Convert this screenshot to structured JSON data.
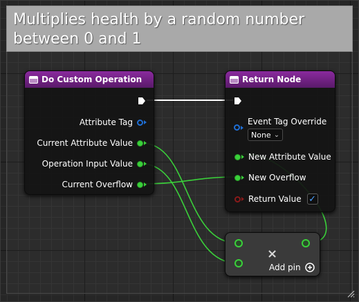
{
  "comment": {
    "text": "Multiplies health by a random number between 0 and 1"
  },
  "custom_node": {
    "title": "Do Custom Operation",
    "pins": [
      {
        "label": "Attribute Tag",
        "type": "tag"
      },
      {
        "label": "Current Attribute Value",
        "type": "float"
      },
      {
        "label": "Operation Input Value",
        "type": "float"
      },
      {
        "label": "Current Overflow",
        "type": "float"
      }
    ]
  },
  "return_node": {
    "title": "Return Node",
    "event_tag_label": "Event Tag Override",
    "event_tag_value": "None",
    "new_attribute_label": "New Attribute Value",
    "new_overflow_label": "New Overflow",
    "return_value_label": "Return Value",
    "return_value_checked": true
  },
  "multiply_node": {
    "operator_symbol": "×",
    "add_pin_label": "Add pin",
    "add_pin_icon": "plus-circle-icon"
  },
  "colors": {
    "header_purple": "#7a2390",
    "float_pin_green": "#3ad03a",
    "tag_pin_blue": "#1f6fd6",
    "bool_pin_red": "#8a1a1a",
    "comment_gray": "#a9a9a9"
  }
}
